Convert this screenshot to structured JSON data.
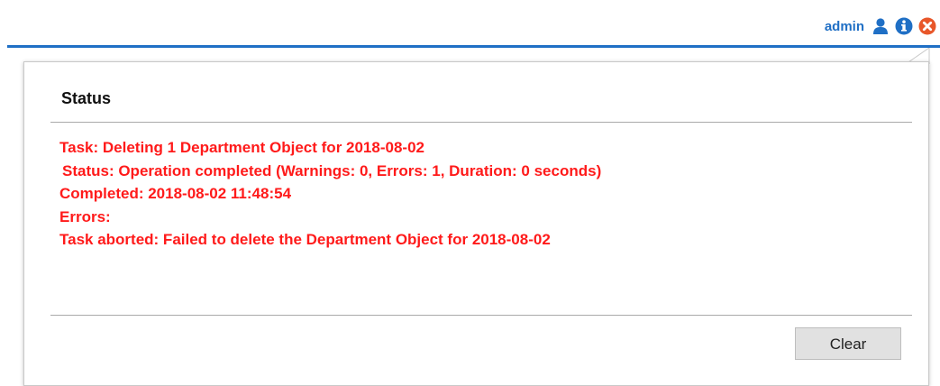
{
  "header": {
    "username": "admin",
    "icons": [
      "user-icon",
      "info-icon",
      "close-circle-icon"
    ],
    "accent_color": "#1f6fc5",
    "close_color": "#e8572a"
  },
  "status_panel": {
    "title": "Status",
    "messages": [
      "Task: Deleting 1 Department Object for 2018-08-02",
      "Status: Operation completed (Warnings: 0, Errors: 1, Duration: 0 seconds)",
      "Completed: 2018-08-02 11:48:54",
      "Errors:",
      "Task aborted: Failed to delete the Department Object for 2018-08-02"
    ],
    "message_color": "#ff1a1a",
    "clear_label": "Clear"
  }
}
